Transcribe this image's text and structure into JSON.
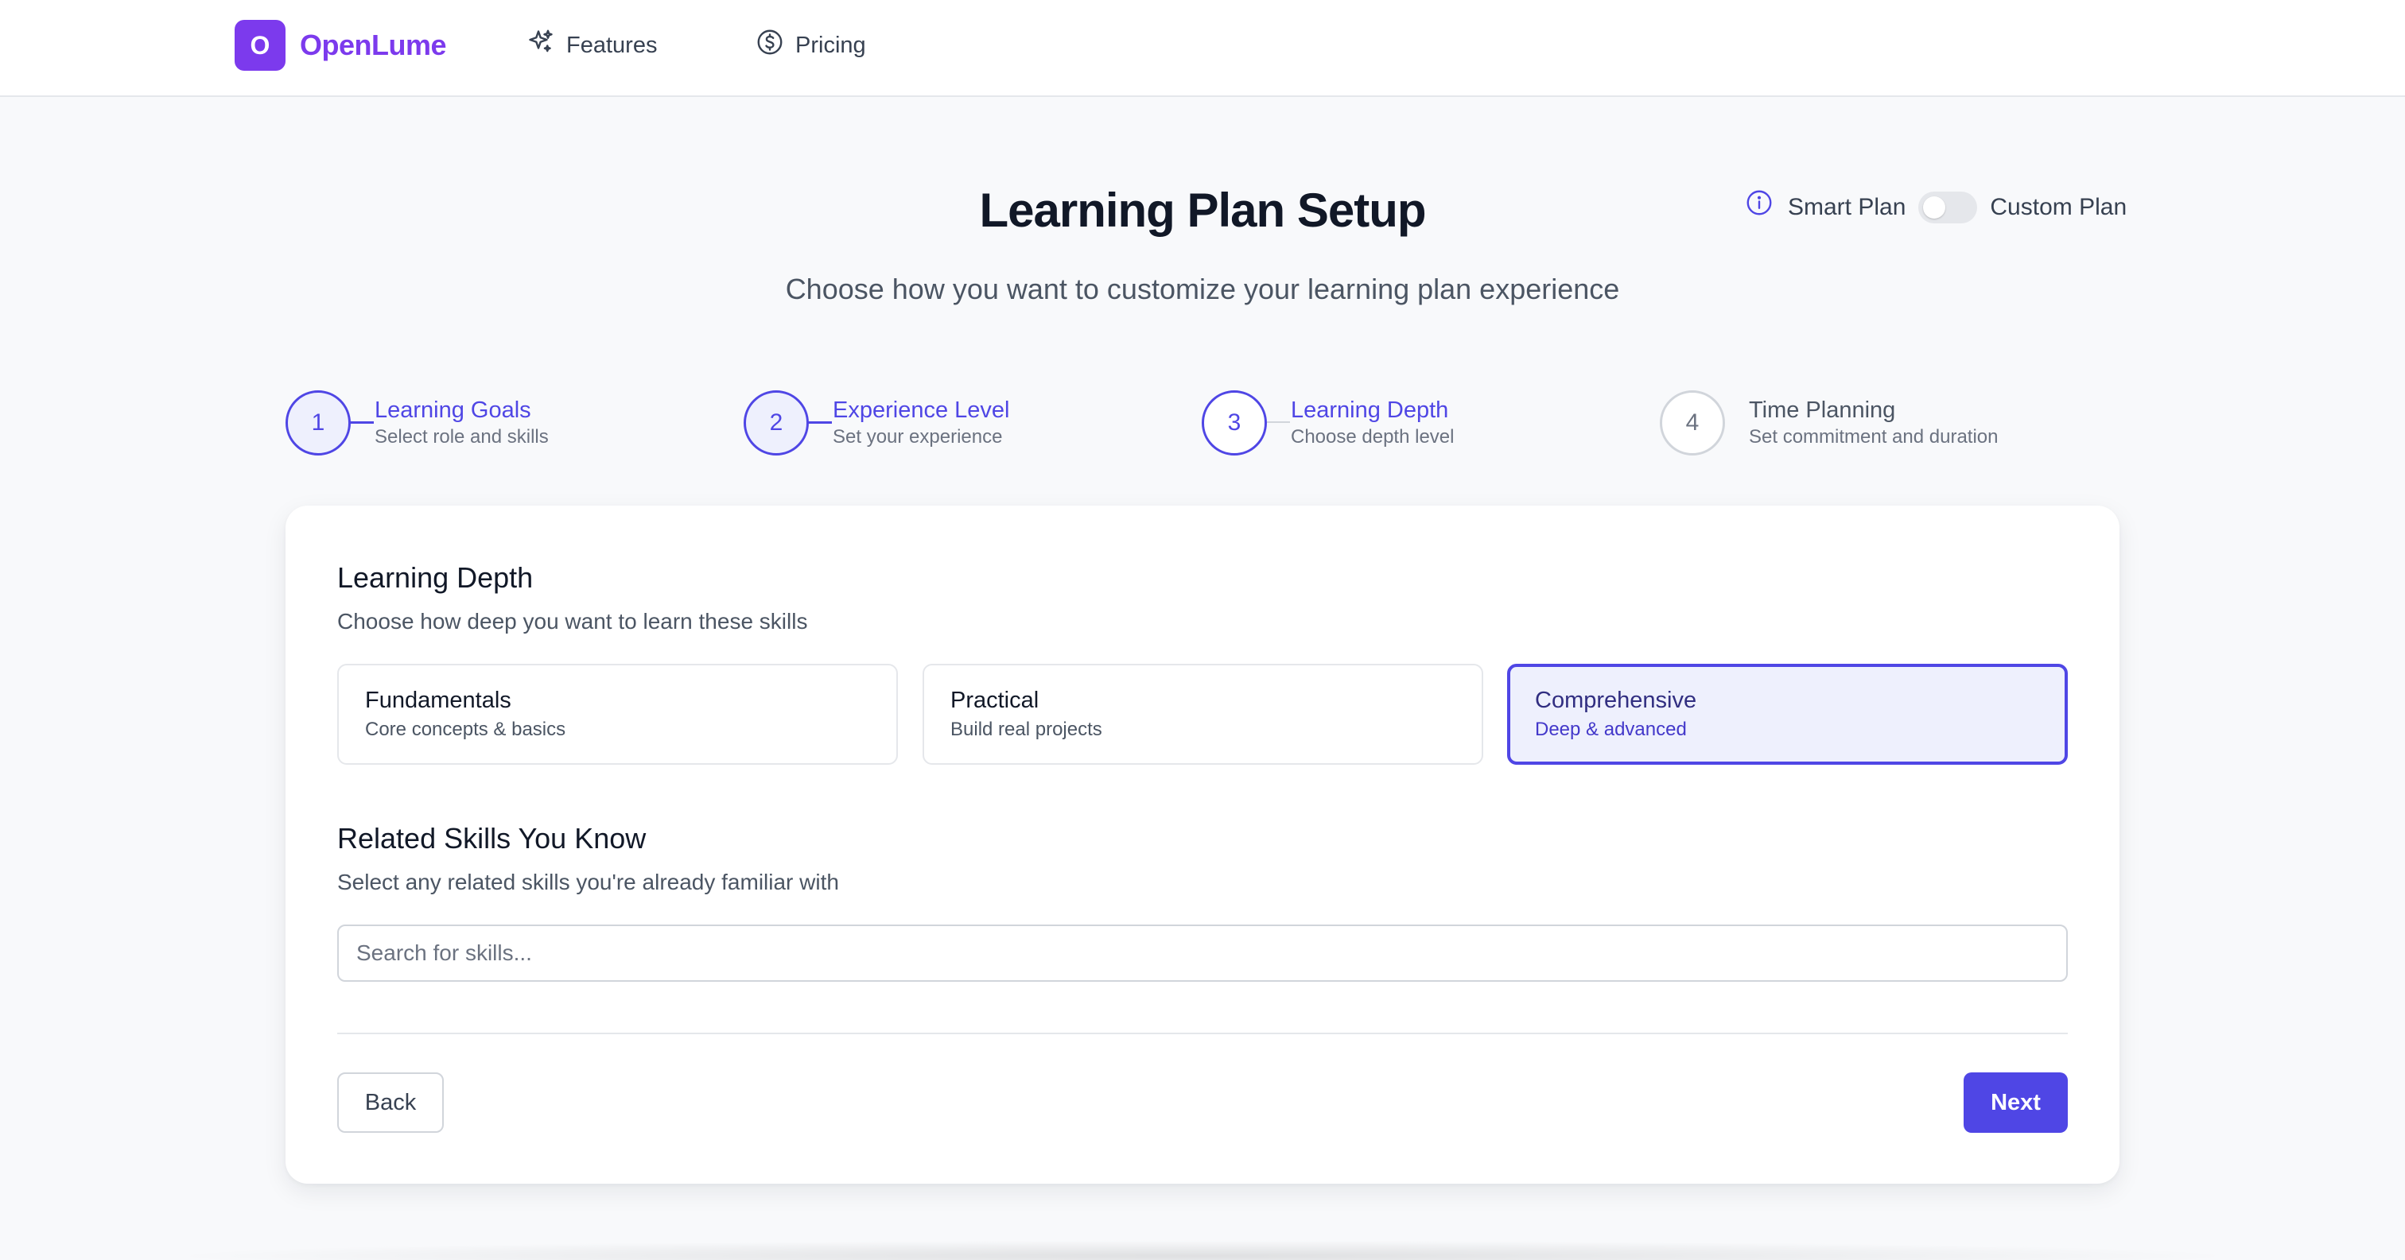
{
  "header": {
    "logo_letter": "O",
    "brand": "OpenLume",
    "nav": [
      {
        "label": "Features",
        "icon": "sparkles-icon"
      },
      {
        "label": "Pricing",
        "icon": "dollar-circle-icon"
      }
    ]
  },
  "title": "Learning Plan Setup",
  "subtitle": "Choose how you want to customize your learning plan experience",
  "plan_toggle": {
    "icon": "info-icon",
    "left_label": "Smart Plan",
    "right_label": "Custom Plan",
    "custom_enabled": false
  },
  "steps": [
    {
      "number": "1",
      "label": "Learning Goals",
      "description": "Select role and skills",
      "state": "completed"
    },
    {
      "number": "2",
      "label": "Experience Level",
      "description": "Set your experience",
      "state": "completed"
    },
    {
      "number": "3",
      "label": "Learning Depth",
      "description": "Choose depth level",
      "state": "current"
    },
    {
      "number": "4",
      "label": "Time Planning",
      "description": "Set commitment and duration",
      "state": "upcoming"
    }
  ],
  "depth": {
    "title": "Learning Depth",
    "subtitle": "Choose how deep you want to learn these skills",
    "options": [
      {
        "title": "Fundamentals",
        "description": "Core concepts & basics",
        "selected": false
      },
      {
        "title": "Practical",
        "description": "Build real projects",
        "selected": false
      },
      {
        "title": "Comprehensive",
        "description": "Deep & advanced",
        "selected": true
      }
    ]
  },
  "related": {
    "title": "Related Skills You Know",
    "subtitle": "Select any related skills you're already familiar with",
    "search_placeholder": "Search for skills...",
    "search_value": ""
  },
  "buttons": {
    "back": "Back",
    "next": "Next"
  },
  "colors": {
    "brand": "#7c3aed",
    "accent": "#4f46e5",
    "selected_bg": "#eef0fd"
  }
}
